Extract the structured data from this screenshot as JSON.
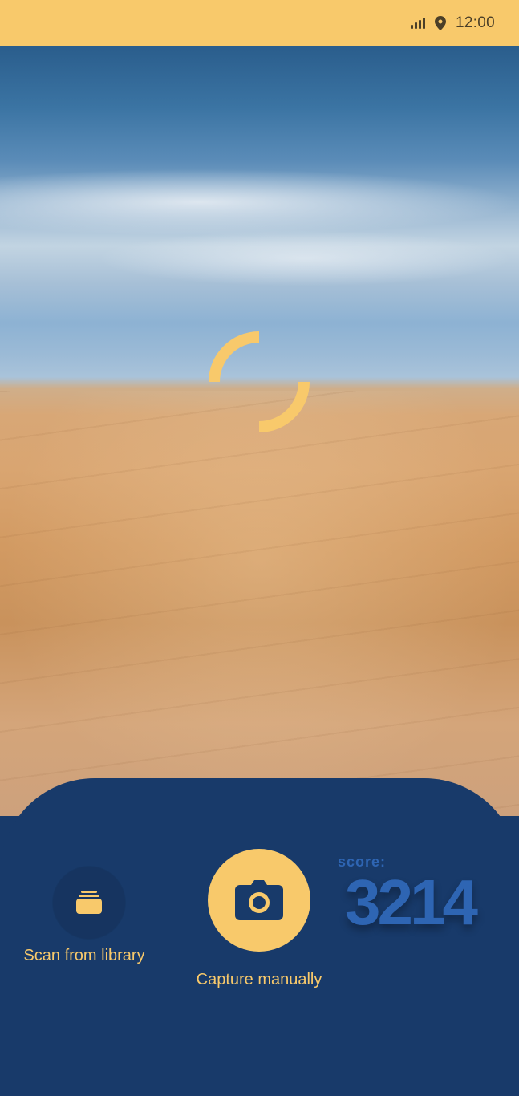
{
  "status_bar": {
    "time": "12:00",
    "icons": [
      "signal-icon",
      "location-pin-icon"
    ]
  },
  "camera": {
    "scene": "beach-viewfinder",
    "loading_indicator": "spinner"
  },
  "actions": {
    "scan_library": {
      "label": "Scan from library",
      "icon": "library-stack-icon"
    },
    "capture": {
      "label": "Capture manually",
      "icon": "camera-icon"
    }
  },
  "score": {
    "label": "score:",
    "value": "3214"
  },
  "colors": {
    "accent": "#f8c96b",
    "panel": "#183a6a",
    "score": "#2e65b3"
  }
}
